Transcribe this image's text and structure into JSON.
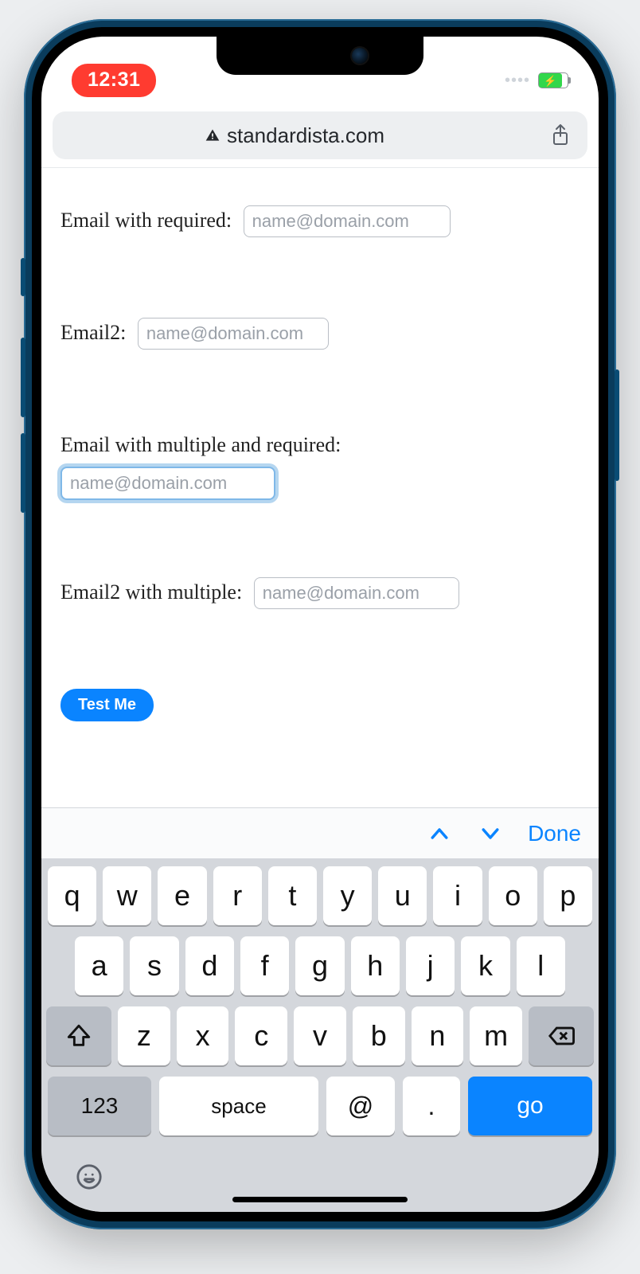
{
  "status": {
    "time": "12:31"
  },
  "browser": {
    "url_display": "standardista.com"
  },
  "form": {
    "field1": {
      "label": "Email with required:",
      "placeholder": "name@domain.com",
      "value": ""
    },
    "field2": {
      "label": "Email2:",
      "placeholder": "name@domain.com",
      "value": ""
    },
    "field3": {
      "label": "Email with multiple and required:",
      "placeholder": "name@domain.com",
      "value": ""
    },
    "field4": {
      "label": "Email2 with multiple:",
      "placeholder": "name@domain.com",
      "value": ""
    },
    "submit_label": "Test Me"
  },
  "keyboard": {
    "accessory_done": "Done",
    "row1": [
      "q",
      "w",
      "e",
      "r",
      "t",
      "y",
      "u",
      "i",
      "o",
      "p"
    ],
    "row2": [
      "a",
      "s",
      "d",
      "f",
      "g",
      "h",
      "j",
      "k",
      "l"
    ],
    "row3": [
      "z",
      "x",
      "c",
      "v",
      "b",
      "n",
      "m"
    ],
    "key_123": "123",
    "key_space": "space",
    "key_at": "@",
    "key_dot": ".",
    "key_go": "go"
  }
}
